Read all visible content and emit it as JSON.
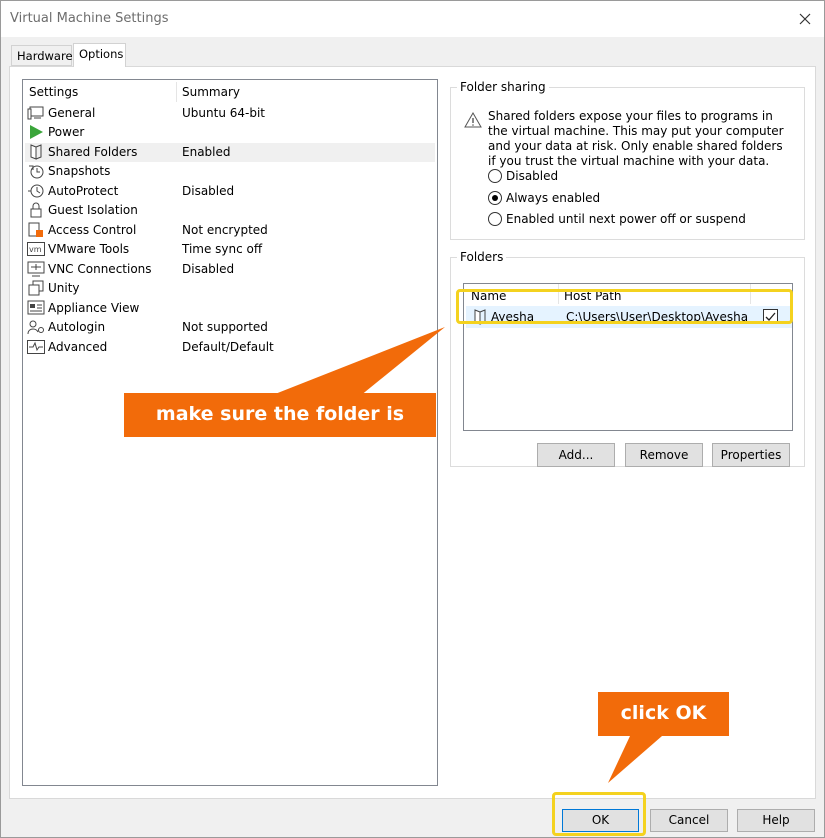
{
  "window": {
    "title": "Virtual Machine Settings"
  },
  "tabs": [
    {
      "label": "Hardware",
      "active": false
    },
    {
      "label": "Options",
      "active": true
    }
  ],
  "settings": {
    "columns": {
      "settings": "Settings",
      "summary": "Summary"
    },
    "items": [
      {
        "name": "General",
        "summary": "Ubuntu 64-bit",
        "icon": "monitor-icon"
      },
      {
        "name": "Power",
        "summary": "",
        "icon": "play-icon"
      },
      {
        "name": "Shared Folders",
        "summary": "Enabled",
        "icon": "shared-folder-icon",
        "selected": true
      },
      {
        "name": "Snapshots",
        "summary": "",
        "icon": "snapshot-clock-icon"
      },
      {
        "name": "AutoProtect",
        "summary": "Disabled",
        "icon": "autoprotect-icon"
      },
      {
        "name": "Guest Isolation",
        "summary": "",
        "icon": "lock-icon"
      },
      {
        "name": "Access Control",
        "summary": "Not encrypted",
        "icon": "access-control-icon"
      },
      {
        "name": "VMware Tools",
        "summary": "Time sync off",
        "icon": "vm-icon"
      },
      {
        "name": "VNC Connections",
        "summary": "Disabled",
        "icon": "vnc-icon"
      },
      {
        "name": "Unity",
        "summary": "",
        "icon": "unity-icon"
      },
      {
        "name": "Appliance View",
        "summary": "",
        "icon": "appliance-icon"
      },
      {
        "name": "Autologin",
        "summary": "Not supported",
        "icon": "autologin-icon"
      },
      {
        "name": "Advanced",
        "summary": "Default/Default",
        "icon": "pulse-icon"
      }
    ]
  },
  "folder_sharing": {
    "title": "Folder sharing",
    "warning": "Shared folders expose your files to programs in the virtual machine. This may put your computer and your data at risk. Only enable shared folders if you trust the virtual machine with your data.",
    "options": [
      {
        "label": "Disabled",
        "selected": false
      },
      {
        "label": "Always enabled",
        "selected": true
      },
      {
        "label": "Enabled until next power off or suspend",
        "selected": false
      }
    ]
  },
  "folders": {
    "title": "Folders",
    "columns": {
      "name": "Name",
      "host_path": "Host Path"
    },
    "rows": [
      {
        "name": "Ayesha",
        "host_path": "C:\\Users\\User\\Desktop\\Ayesha",
        "enabled": true
      }
    ],
    "buttons": {
      "add": "Add...",
      "remove": "Remove",
      "properties": "Properties"
    }
  },
  "footer": {
    "ok": "OK",
    "cancel": "Cancel",
    "help": "Help"
  },
  "annotations": {
    "folder_callout": "make sure the folder is added",
    "ok_callout": "click OK"
  },
  "colors": {
    "callout": "#f26b0a",
    "highlight": "#f4d21f",
    "play": "#3aa53a"
  }
}
